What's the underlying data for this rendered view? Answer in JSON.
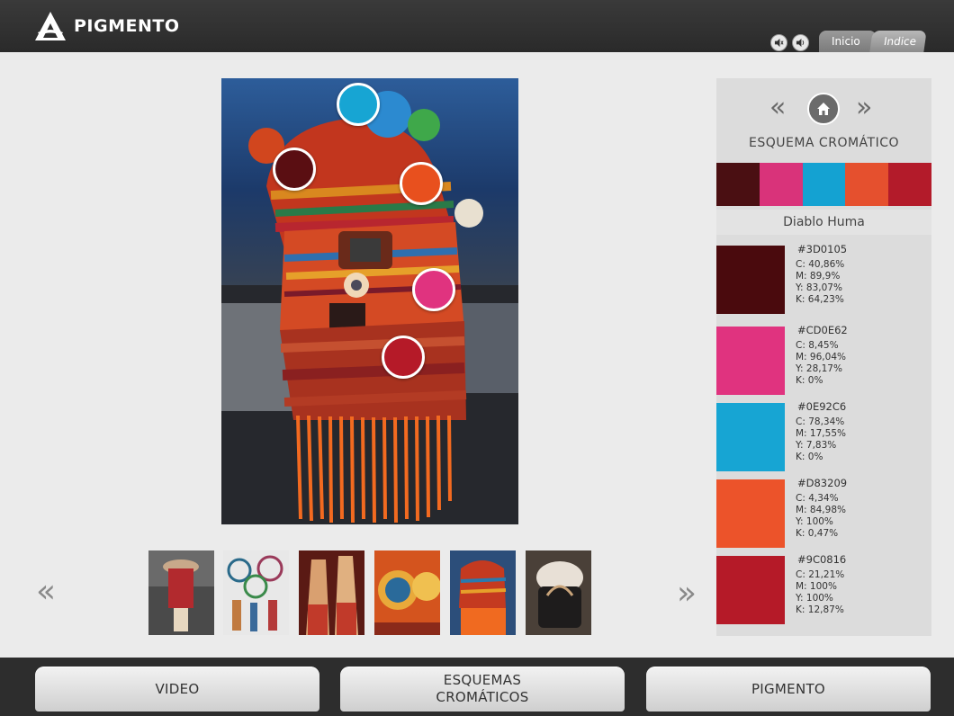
{
  "app": {
    "logo_text": "PIGMENTO"
  },
  "top_tabs": {
    "inicio": "Inicio",
    "indice": "Indice"
  },
  "panel": {
    "scheme_title": "ESQUEMA CROMÁTICO",
    "item_name": "Diablo Huma",
    "strip_colors": [
      "#3D0105",
      "#CD0E62",
      "#0E92C6",
      "#D83209",
      "#9C0816"
    ],
    "swatches": [
      {
        "hex": "#3D0105",
        "c": "C: 40,86%",
        "m": "M: 89,9%",
        "y": "Y: 83,07%",
        "k": "K: 64,23%"
      },
      {
        "hex": "#CD0E62",
        "c": "C: 8,45%",
        "m": "M: 96,04%",
        "y": "Y: 28,17%",
        "k": "K: 0%"
      },
      {
        "hex": "#0E92C6",
        "c": "C: 78,34%",
        "m": "M: 17,55%",
        "y": "Y: 7,83%",
        "k": "K: 0%"
      },
      {
        "hex": "#D83209",
        "c": "C: 4,34%",
        "m": "M: 84,98%",
        "y": "Y: 100%",
        "k": "K: 0,47%"
      },
      {
        "hex": "#9C0816",
        "c": "C: 21,21%",
        "m": "M: 100%",
        "y": "Y: 100%",
        "k": "K: 12,87%"
      }
    ]
  },
  "colors": {
    "swatch_1": "#4a0a0d",
    "swatch_2": "#e0337f",
    "swatch_3": "#17a5d3",
    "swatch_4": "#ec532a",
    "swatch_5": "#b51a28"
  },
  "bottom_nav": {
    "video": "VIDEO",
    "esquemas_line1": "ESQUEMAS",
    "esquemas_line2": "CROMÁTICOS",
    "pigmento": "PIGMENTO"
  },
  "icons": {
    "prev": "double-chevron-left-icon",
    "next": "double-chevron-right-icon",
    "home": "home-icon",
    "sound": "speaker-icon"
  }
}
